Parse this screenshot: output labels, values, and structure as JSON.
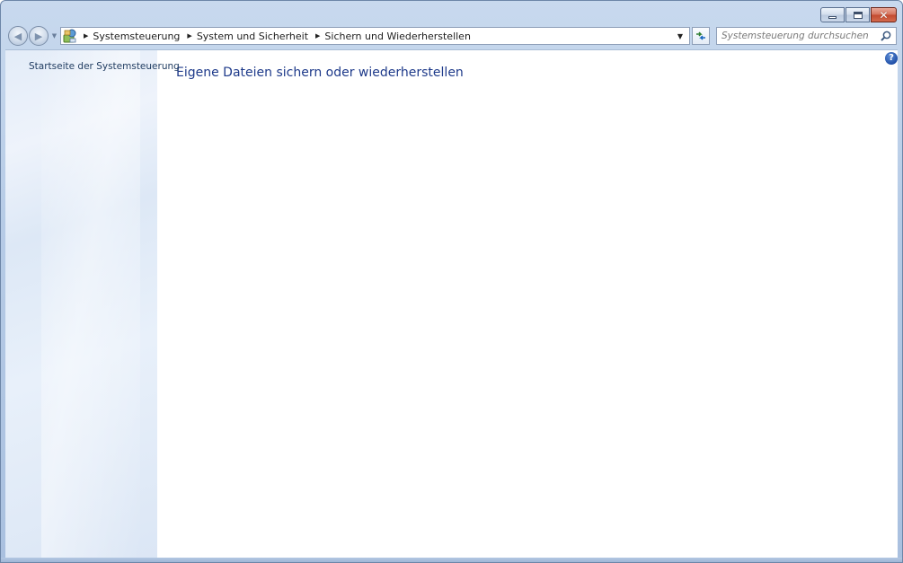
{
  "navigation": {
    "breadcrumbs": [
      "Systemsteuerung",
      "System und Sicherheit",
      "Sichern und Wiederherstellen"
    ]
  },
  "search": {
    "placeholder": "Systemsteuerung durchsuchen"
  },
  "sidebar": {
    "home_link": "Startseite der Systemsteuerung"
  },
  "main": {
    "title": "Eigene Dateien sichern oder wiederherstellen"
  },
  "icons": {
    "back": "back-arrow-icon",
    "forward": "forward-arrow-icon",
    "address": "control-panel-icon",
    "refresh": "refresh-icon",
    "search": "magnifier-icon",
    "help": "help-icon",
    "minimize": "minimize-icon",
    "maximize": "maximize-icon",
    "close": "close-icon"
  },
  "colors": {
    "link": "#1e3a5f",
    "title": "#1e3a8a",
    "close_button": "#c24a2f"
  }
}
